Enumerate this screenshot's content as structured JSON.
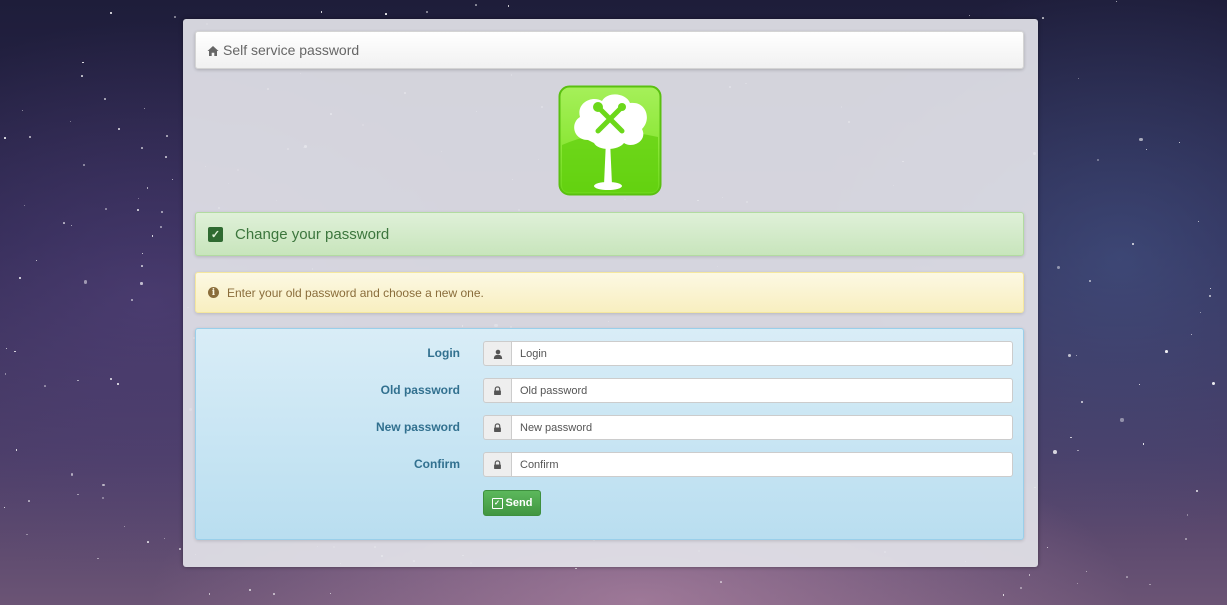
{
  "navbar": {
    "icon": "home-icon",
    "title": "Self service password"
  },
  "logo": {
    "icon": "tree-tools-logo",
    "color": "#7fe22c"
  },
  "success_alert": {
    "icon": "check-square-icon",
    "text": "Change your password"
  },
  "info_alert": {
    "icon": "info-circle-icon",
    "text": "Enter your old password and choose a new one."
  },
  "form": {
    "fields": [
      {
        "label": "Login",
        "icon": "user-icon",
        "placeholder": "Login",
        "value": ""
      },
      {
        "label": "Old password",
        "icon": "lock-icon",
        "placeholder": "Old password",
        "value": ""
      },
      {
        "label": "New password",
        "icon": "lock-icon",
        "placeholder": "New password",
        "value": ""
      },
      {
        "label": "Confirm",
        "icon": "lock-icon",
        "placeholder": "Confirm",
        "value": ""
      }
    ],
    "submit": {
      "icon": "edit-icon",
      "label": "Send"
    }
  },
  "colors": {
    "success": "#3c763d",
    "warning": "#8a6d3b",
    "info": "#31708f",
    "button": "#5cb85c"
  }
}
